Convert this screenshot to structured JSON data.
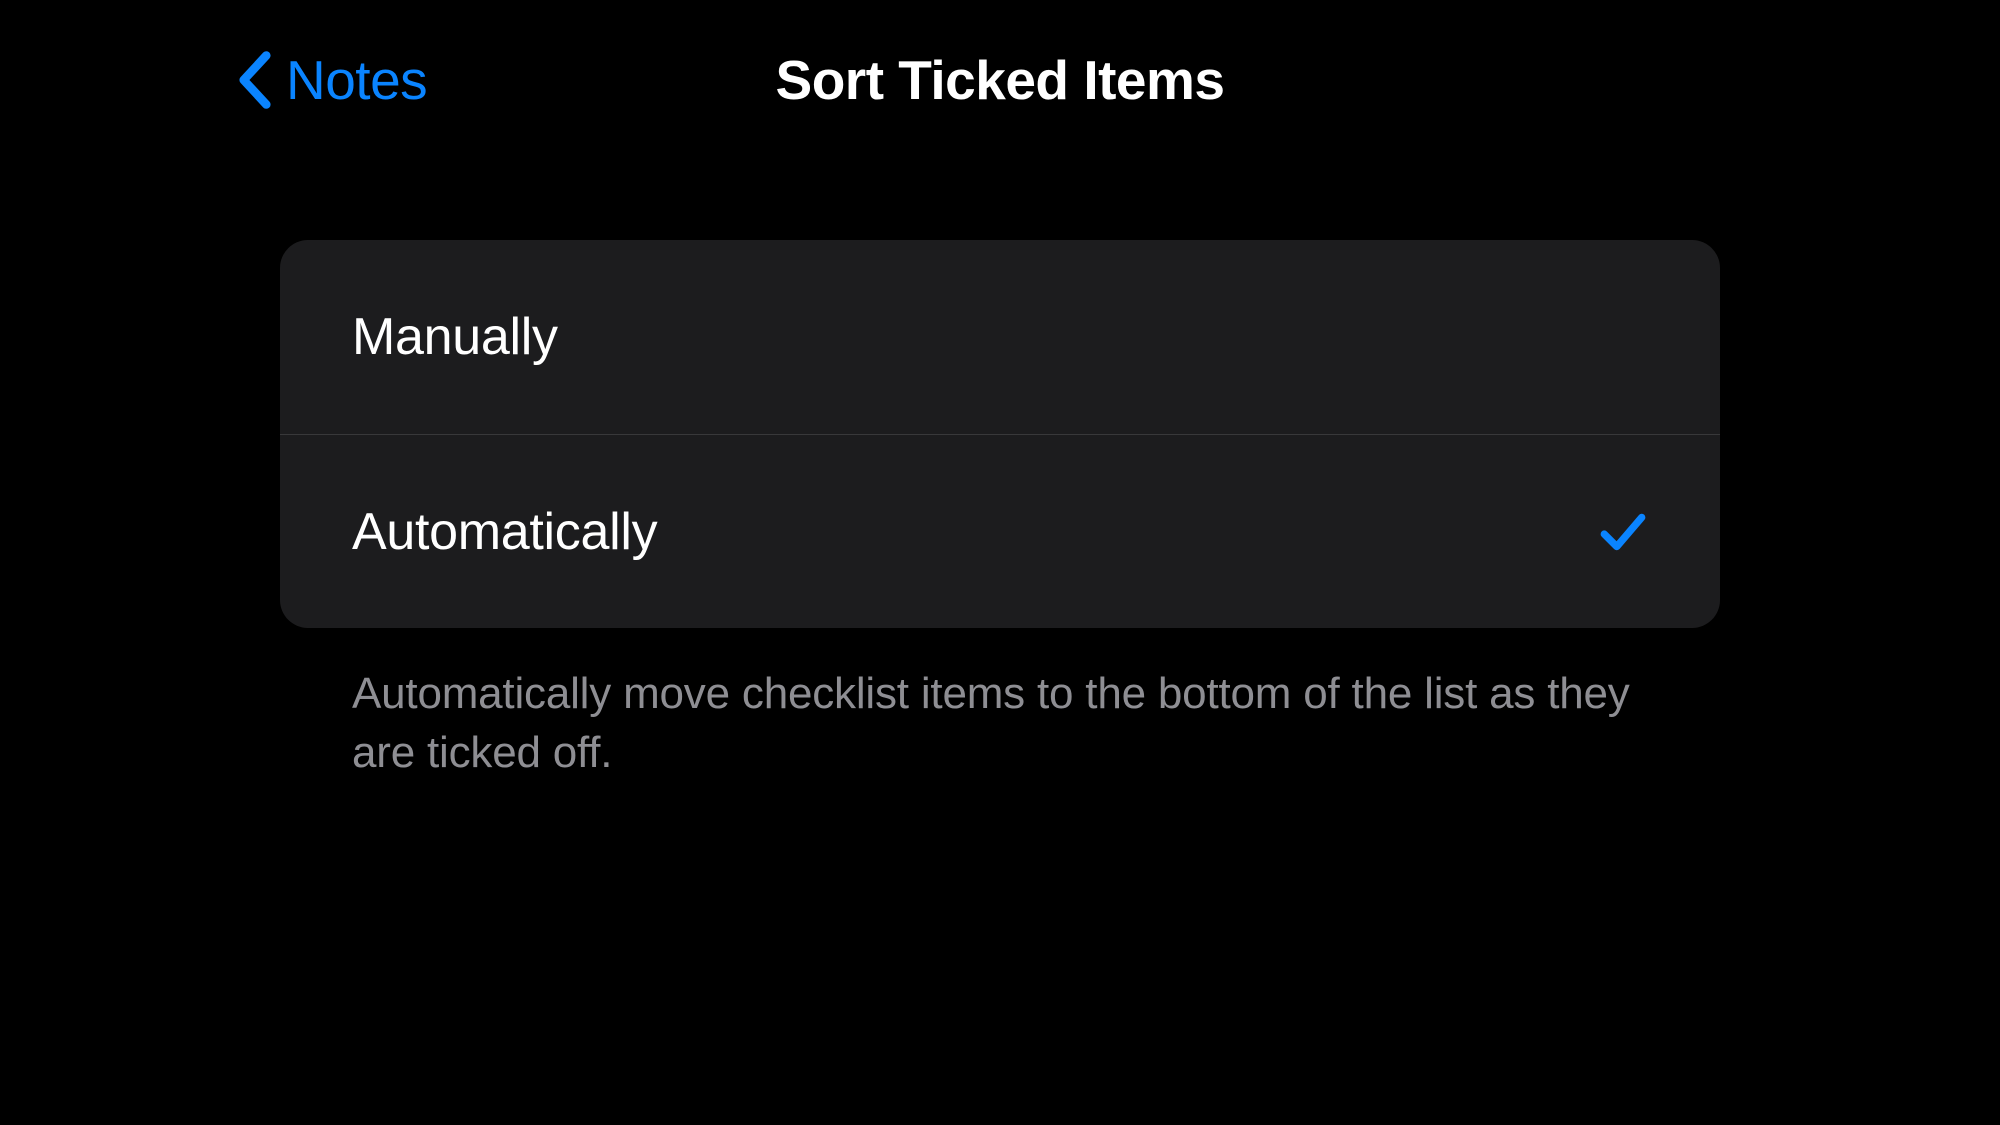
{
  "nav": {
    "back_label": "Notes",
    "title": "Sort Ticked Items"
  },
  "options": [
    {
      "label": "Manually",
      "selected": false
    },
    {
      "label": "Automatically",
      "selected": true
    }
  ],
  "footer": "Automatically move checklist items to the bottom of the list as they are ticked off.",
  "colors": {
    "accent": "#0a84ff",
    "background": "#000000",
    "group_background": "#1c1c1e",
    "separator": "#38383a",
    "secondary_text": "#8e8e93"
  }
}
